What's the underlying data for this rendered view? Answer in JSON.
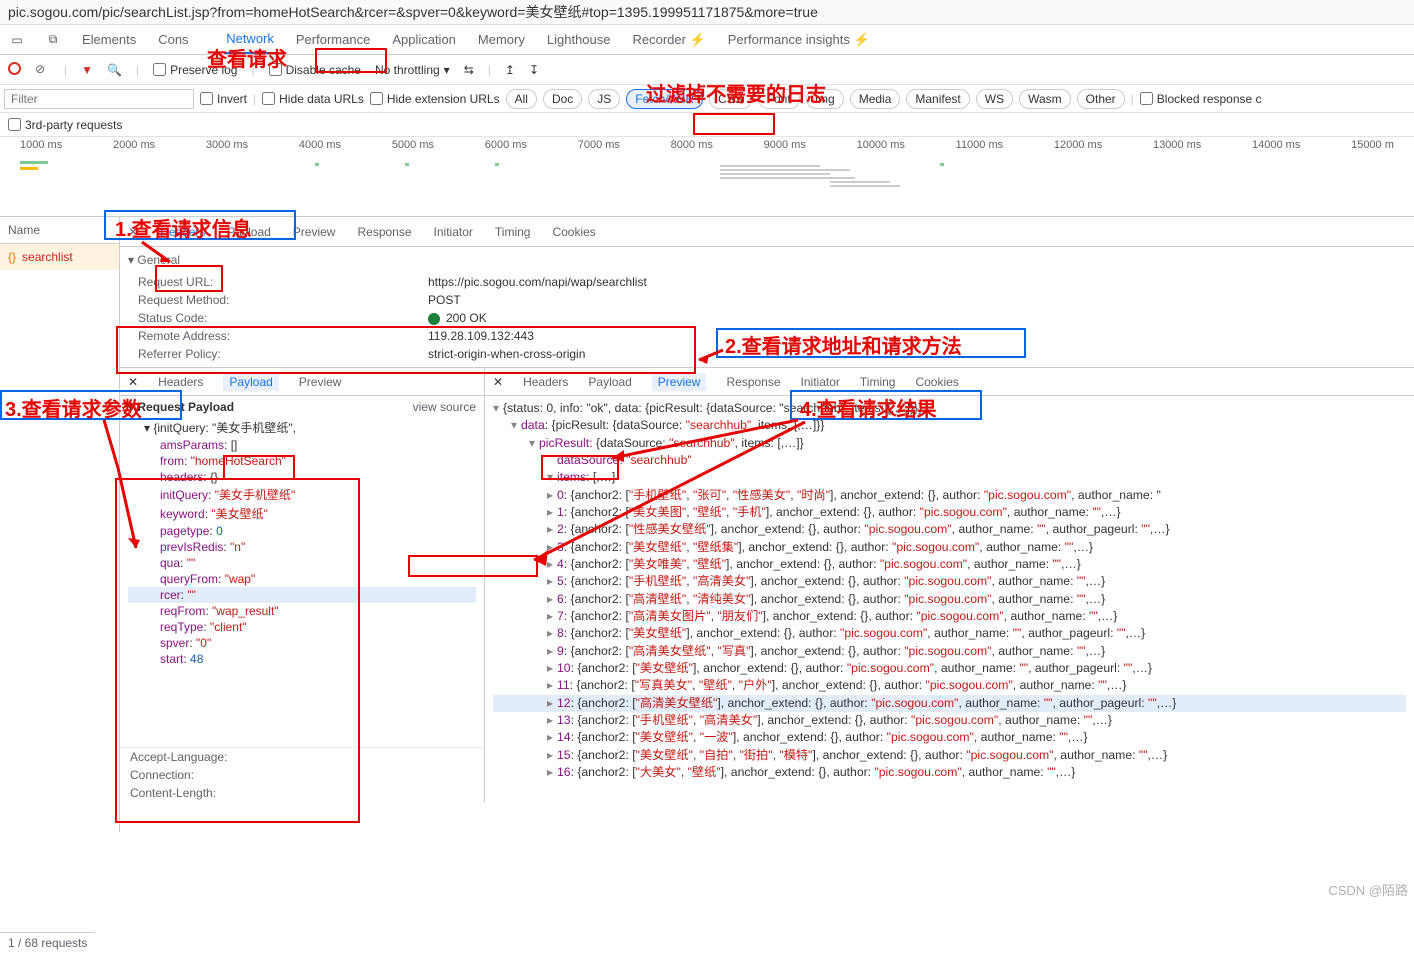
{
  "url": "pic.sogou.com/pic/searchList.jsp?from=homeHotSearch&rcer=&spver=0&keyword=美女壁纸#top=1395.199951171875&more=true",
  "mainTabs": [
    "Elements",
    "Console",
    "Network",
    "Performance",
    "Application",
    "Memory",
    "Lighthouse",
    "Recorder ⚡",
    "Performance insights ⚡"
  ],
  "annotations": {
    "view_request": "查看请求",
    "filter_logs": "过滤掉不需要的日志",
    "step1": "1.查看请求信息",
    "step2": "2.查看请求地址和请求方法",
    "step3": "3.查看请求参数",
    "step4": "4.查看请求结果"
  },
  "toolbar": {
    "preserve": "Preserve log",
    "disable_cache": "Disable cache",
    "throttle": "No throttling",
    "invert": "Invert",
    "hide_data": "Hide data URLs",
    "hide_ext": "Hide extension URLs",
    "blocked": "Blocked response c",
    "third_party": "3rd-party requests",
    "filter_ph": "Filter"
  },
  "filter_pills": [
    "All",
    "Doc",
    "JS",
    "Fetch/XHR",
    "CSS",
    "Font",
    "Img",
    "Media",
    "Manifest",
    "WS",
    "Wasm",
    "Other"
  ],
  "timeline_ticks": [
    "1000 ms",
    "2000 ms",
    "3000 ms",
    "4000 ms",
    "5000 ms",
    "6000 ms",
    "7000 ms",
    "8000 ms",
    "9000 ms",
    "10000 ms",
    "11000 ms",
    "12000 ms",
    "13000 ms",
    "14000 ms",
    "15000 m"
  ],
  "detail_tabs": [
    "Headers",
    "Payload",
    "Preview",
    "Response",
    "Initiator",
    "Timing",
    "Cookies"
  ],
  "name_header": "Name",
  "request_name": "searchlist",
  "general_label": "General",
  "general": {
    "url_l": "Request URL:",
    "url_v": "https://pic.sogou.com/napi/wap/searchlist",
    "method_l": "Request Method:",
    "method_v": "POST",
    "status_l": "Status Code:",
    "status_v": "200 OK",
    "addr_l": "Remote Address:",
    "addr_v": "119.28.109.132:443",
    "ref_l": "Referrer Policy:",
    "ref_v": "strict-origin-when-cross-origin"
  },
  "headers_below": [
    "Accept-Language:",
    "Connection:",
    "Content-Length:"
  ],
  "payload_tabs": [
    "Headers",
    "Payload",
    "Preview"
  ],
  "payload_title": "Request Payload",
  "view_source": "view source",
  "payload": {
    "root": "{initQuery: \"美女手机壁纸\",",
    "items": [
      {
        "k": "amsParams",
        "v": "[]",
        "t": "obj"
      },
      {
        "k": "from",
        "v": "\"homeHotSearch\"",
        "t": "str"
      },
      {
        "k": "headers",
        "v": "{}",
        "t": "obj"
      },
      {
        "k": "initQuery",
        "v": "\"美女手机壁纸\"",
        "t": "str"
      },
      {
        "k": "keyword",
        "v": "\"美女壁纸\"",
        "t": "str"
      },
      {
        "k": "pagetype",
        "v": "0",
        "t": "num"
      },
      {
        "k": "prevIsRedis",
        "v": "\"n\"",
        "t": "str"
      },
      {
        "k": "qua",
        "v": "\"\"",
        "t": "str"
      },
      {
        "k": "queryFrom",
        "v": "\"wap\"",
        "t": "str"
      },
      {
        "k": "rcer",
        "v": "\"\"",
        "t": "str",
        "hl": true
      },
      {
        "k": "reqFrom",
        "v": "\"wap_result\"",
        "t": "str"
      },
      {
        "k": "reqType",
        "v": "\"client\"",
        "t": "str"
      },
      {
        "k": "spver",
        "v": "\"0\"",
        "t": "str"
      },
      {
        "k": "start",
        "v": "48",
        "t": "num"
      }
    ]
  },
  "preview_tabs": [
    "Headers",
    "Payload",
    "Preview",
    "Response",
    "Initiator",
    "Timing",
    "Cookies"
  ],
  "preview": {
    "line0": "{status: 0, info: \"ok\", data: {picResult: {dataSource: \"searchhub\", items: [,…]}}}",
    "line1": "data: {picResult: {dataSource: \"searchhub\", items: [,…]}}",
    "line2": "picResult: {dataSource: \"searchhub\", items: [,…]}",
    "line3_k": "dataSource:",
    "line3_v": " \"searchhub\"",
    "line4": "items: [,…]",
    "items": [
      "0: {anchor2: [\"手机壁纸\", \"张可\", \"性感美女\", \"时尚\"], anchor_extend: {}, author: \"pic.sogou.com\", author_name: \"",
      "1: {anchor2: [\"美女美图\", \"壁纸\", \"手机\"], anchor_extend: {}, author: \"pic.sogou.com\", author_name: \"\",…}",
      "2: {anchor2: [\"性感美女壁纸\"], anchor_extend: {}, author: \"pic.sogou.com\", author_name: \"\", author_pageurl: \"\",…}",
      "3: {anchor2: [\"美女壁纸\", \"壁纸集\"], anchor_extend: {}, author: \"pic.sogou.com\", author_name: \"\",…}",
      "4: {anchor2: [\"美女唯美\", \"壁纸\"], anchor_extend: {}, author: \"pic.sogou.com\", author_name: \"\",…}",
      "5: {anchor2: [\"手机壁纸\", \"高清美女\"], anchor_extend: {}, author: \"pic.sogou.com\", author_name: \"\",…}",
      "6: {anchor2: [\"高清壁纸\", \"清纯美女\"], anchor_extend: {}, author: \"pic.sogou.com\", author_name: \"\",…}",
      "7: {anchor2: [\"高清美女图片\", \"朋友们\"], anchor_extend: {}, author: \"pic.sogou.com\", author_name: \"\",…}",
      "8: {anchor2: [\"美女壁纸\"], anchor_extend: {}, author: \"pic.sogou.com\", author_name: \"\", author_pageurl: \"\",…}",
      "9: {anchor2: [\"高清美女壁纸\", \"写真\"], anchor_extend: {}, author: \"pic.sogou.com\", author_name: \"\",…}",
      "10: {anchor2: [\"美女壁纸\"], anchor_extend: {}, author: \"pic.sogou.com\", author_name: \"\", author_pageurl: \"\",…}",
      "11: {anchor2: [\"写真美女\", \"壁纸\", \"户外\"], anchor_extend: {}, author: \"pic.sogou.com\", author_name: \"\",…}",
      "12: {anchor2: [\"高清美女壁纸\"], anchor_extend: {}, author: \"pic.sogou.com\", author_name: \"\", author_pageurl: \"\",…}",
      "13: {anchor2: [\"手机壁纸\", \"高清美女\"], anchor_extend: {}, author: \"pic.sogou.com\", author_name: \"\",…}",
      "14: {anchor2: [\"美女壁纸\", \"一波\"], anchor_extend: {}, author: \"pic.sogou.com\", author_name: \"\",…}",
      "15: {anchor2: [\"美女壁纸\", \"自拍\", \"街拍\", \"模特\"], anchor_extend: {}, author: \"pic.sogou.com\", author_name: \"\",…}",
      "16: {anchor2: [\"大美女\", \"壁纸\"], anchor_extend: {}, author: \"pic.sogou.com\", author_name: \"\",…}"
    ]
  },
  "status": "1 / 68 requests",
  "watermark": "CSDN @陌路"
}
